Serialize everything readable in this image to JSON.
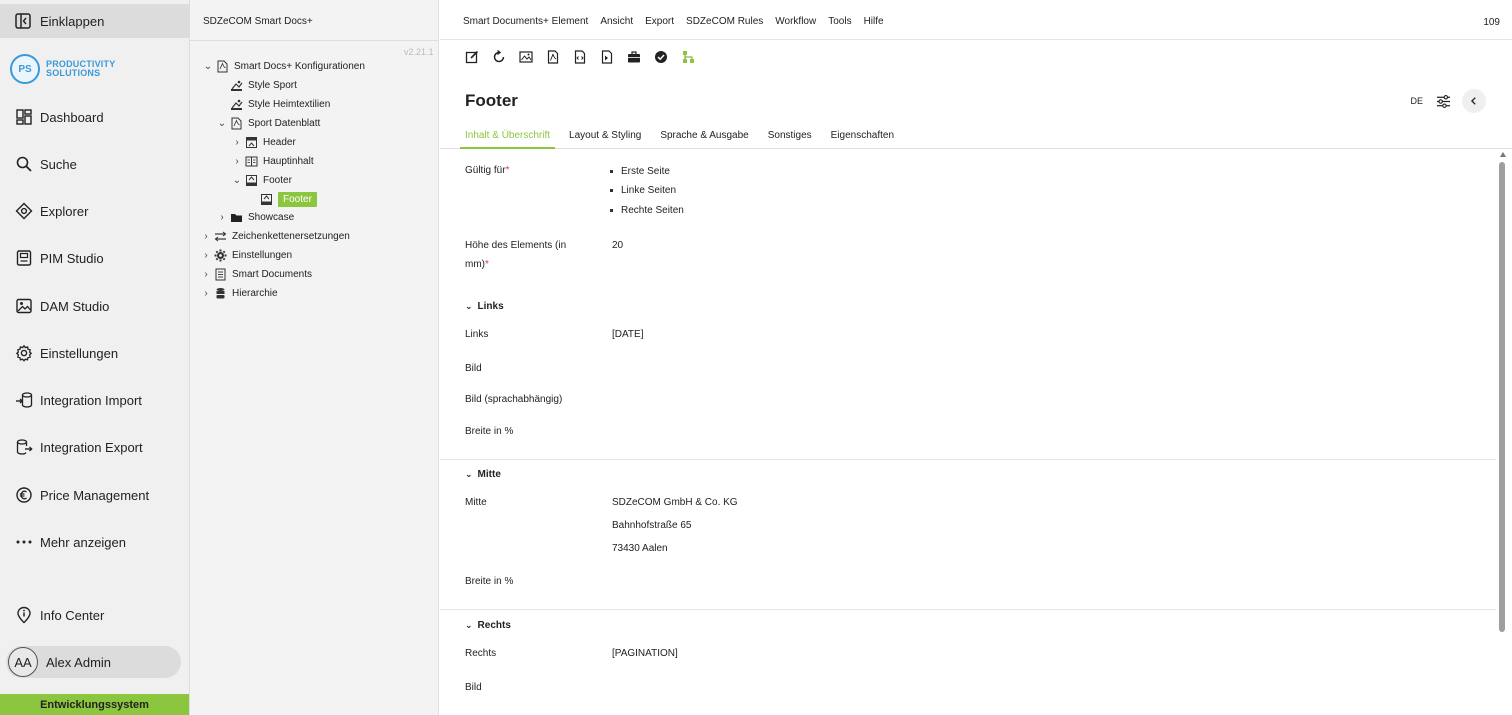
{
  "nav": {
    "collapse_label": "Einklappen",
    "logo_mark": "PS",
    "logo_line1": "PRODUCTIVITY",
    "logo_line2": "SOLUTIONS",
    "items": [
      {
        "label": "Dashboard",
        "icon": "dashboard-icon"
      },
      {
        "label": "Suche",
        "icon": "search-icon"
      },
      {
        "label": "Explorer",
        "icon": "explorer-icon"
      },
      {
        "label": "PIM Studio",
        "icon": "pim-icon"
      },
      {
        "label": "DAM Studio",
        "icon": "image-icon"
      },
      {
        "label": "Einstellungen",
        "icon": "gear-icon"
      },
      {
        "label": "Integration Import",
        "icon": "import-icon"
      },
      {
        "label": "Integration Export",
        "icon": "export-icon"
      },
      {
        "label": "Price Management",
        "icon": "euro-icon"
      },
      {
        "label": "Mehr anzeigen",
        "icon": "more-icon"
      }
    ],
    "info_center": "Info Center",
    "user_initials": "AA",
    "user_name": "Alex Admin",
    "environment": "Entwicklungssystem"
  },
  "tree": {
    "title": "SDZeCOM Smart Docs+",
    "version": "v2.21.1",
    "nodes": [
      {
        "label": "Smart Docs+ Konfigurationen",
        "chevron": "v"
      },
      {
        "label": "Style Sport",
        "chevron": ""
      },
      {
        "label": "Style Heimtextilien",
        "chevron": ""
      },
      {
        "label": "Sport Datenblatt",
        "chevron": "v"
      },
      {
        "label": "Header",
        "chevron": ">"
      },
      {
        "label": "Hauptinhalt",
        "chevron": ">"
      },
      {
        "label": "Footer",
        "chevron": "v"
      },
      {
        "label": "Footer",
        "chevron": ""
      },
      {
        "label": "Showcase",
        "chevron": ">"
      },
      {
        "label": "Zeichenkettenersetzungen",
        "chevron": ">"
      },
      {
        "label": "Einstellungen",
        "chevron": ">"
      },
      {
        "label": "Smart Documents",
        "chevron": ">"
      },
      {
        "label": "Hierarchie",
        "chevron": ">"
      }
    ]
  },
  "menubar": {
    "items": [
      "Smart Documents+ Element",
      "Ansicht",
      "Export",
      "SDZeCOM Rules",
      "Workflow",
      "Tools",
      "Hilfe"
    ],
    "counter": "109"
  },
  "toolbar": {
    "icons": [
      "edit-icon",
      "reload-icon",
      "image-pdf-icon",
      "pdf-icon",
      "code-file-icon",
      "file-export-icon",
      "briefcase-icon",
      "check-circle-icon",
      "hierarchy-icon"
    ]
  },
  "header": {
    "title": "Footer",
    "lang": "DE"
  },
  "tabs": [
    "Inhalt & Überschrift",
    "Layout & Styling",
    "Sprache & Ausgabe",
    "Sonstiges",
    "Eigenschaften"
  ],
  "form": {
    "valid_for_label": "Gültig für",
    "valid_for_values": [
      "Erste Seite",
      "Linke Seiten",
      "Rechte Seiten"
    ],
    "height_label_1": "Höhe des Elements (in",
    "height_label_2": "mm)",
    "height_value": "20",
    "required_mark": "*",
    "links": {
      "section": "Links",
      "links_label": "Links",
      "links_value": "[DATE]",
      "bild_label": "Bild",
      "bild_lang_label": "Bild (sprachabhängig)",
      "breite_label": "Breite in %"
    },
    "mitte": {
      "section": "Mitte",
      "mitte_label": "Mitte",
      "mitte_lines": [
        "SDZeCOM GmbH & Co. KG",
        "Bahnhofstraße 65",
        "73430 Aalen"
      ],
      "breite_label": "Breite in %"
    },
    "rechts": {
      "section": "Rechts",
      "rechts_label": "Rechts",
      "rechts_value": "[PAGINATION]",
      "bild_label": "Bild"
    }
  },
  "colors": {
    "accent": "#8cc63f",
    "logo_blue": "#3a9ad9",
    "required": "#e53935"
  }
}
